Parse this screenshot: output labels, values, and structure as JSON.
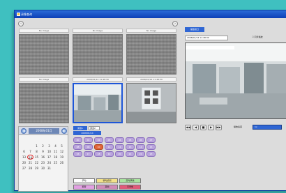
{
  "window": {
    "title": "录像查询"
  },
  "cameras": [
    {
      "caption": "No Image",
      "live": false
    },
    {
      "caption": "No Image",
      "live": false
    },
    {
      "caption": "No Image",
      "live": false
    },
    {
      "caption": "No Image",
      "live": false
    },
    {
      "caption": "2008/01/14 11:48:30",
      "live": true
    },
    {
      "caption": "2008/01/14 11:48:30",
      "live": true
    }
  ],
  "right": {
    "tab": "播放窗口",
    "timestamp": "2008/01/14 11:48:30",
    "checkbox": "同步播放",
    "controls": [
      "◀◀",
      "◀",
      "■",
      "▶",
      "▶▶"
    ],
    "speed_label": "播放速度",
    "speed_value": "1x"
  },
  "calendar": {
    "title": "2008年01月",
    "prev": "◀",
    "next": "▶",
    "days": [
      "1",
      "2",
      "3",
      "4",
      "5",
      "6",
      "7",
      "8",
      "9",
      "10",
      "11",
      "12",
      "13",
      "14",
      "15",
      "16",
      "17",
      "18",
      "19",
      "20",
      "21",
      "22",
      "23",
      "24",
      "25",
      "26",
      "27",
      "28",
      "29",
      "30",
      "31"
    ],
    "today": "14"
  },
  "list": {
    "tab1": "通道1",
    "tab2": "通道2",
    "field": "2008/01/14"
  },
  "hours": [
    "00",
    "01",
    "02",
    "03",
    "04",
    "05",
    "06",
    "07",
    "08",
    "09",
    "10",
    "11",
    "12",
    "13",
    "14",
    "15",
    "16",
    "17",
    "18",
    "19",
    "20",
    "21",
    "22",
    "23"
  ],
  "legend": [
    "手动",
    "移动侦测",
    "定时录像",
    "报警",
    "其他",
    "无录像"
  ]
}
